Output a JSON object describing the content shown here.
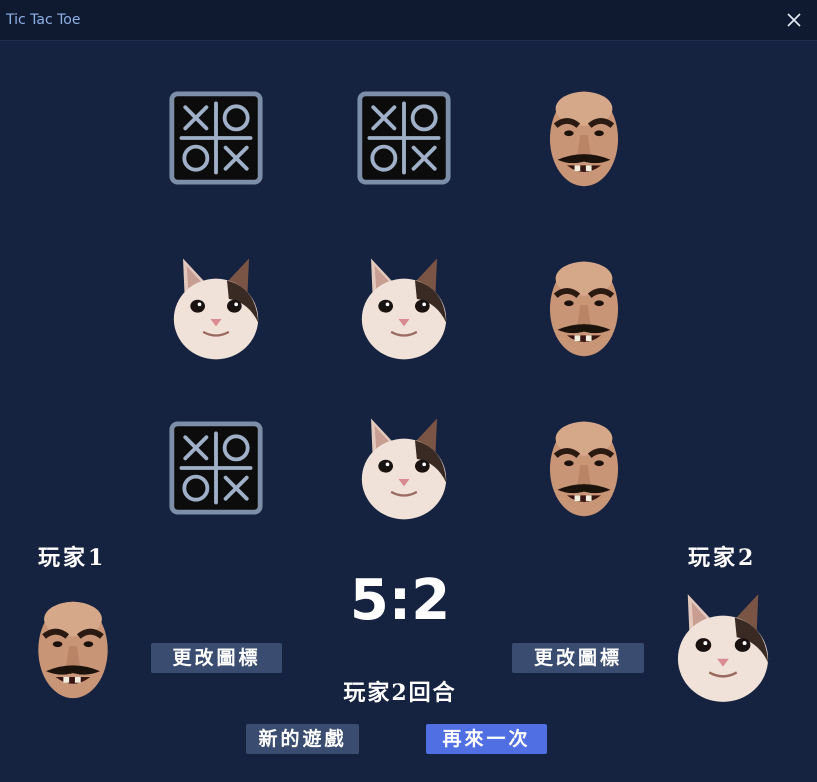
{
  "window": {
    "title": "Tic Tac Toe"
  },
  "board": {
    "cells": [
      [
        "empty",
        "empty",
        "man"
      ],
      [
        "cat",
        "cat",
        "man"
      ],
      [
        "empty",
        "cat",
        "man"
      ]
    ]
  },
  "players": {
    "p1": {
      "label": "玩家1",
      "icon": "man-face-icon"
    },
    "p2": {
      "label": "玩家2",
      "icon": "cat-face-icon"
    }
  },
  "score": "5:2",
  "turn_text": "玩家2回合",
  "buttons": {
    "change_icon_p1": "更改圖標",
    "change_icon_p2": "更改圖標",
    "new_game": "新的遊戲",
    "play_again": "再來一次"
  },
  "colors": {
    "background": "#162340",
    "titlebar": "#0f1a30",
    "button_gray": "#3a4d70",
    "button_blue": "#4f6fe3"
  }
}
